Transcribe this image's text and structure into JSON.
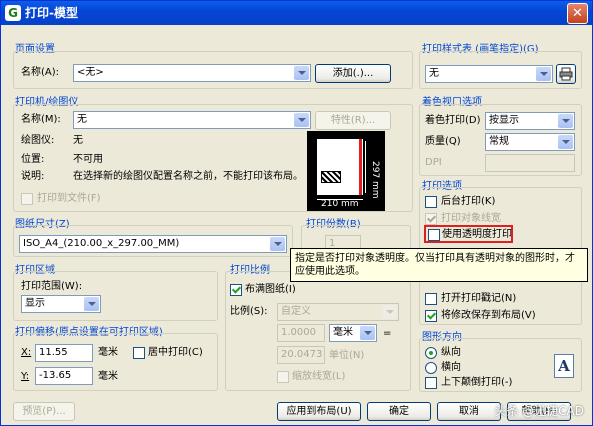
{
  "window": {
    "title": "打印-模型",
    "app_icon": "G"
  },
  "page_setup": {
    "header": "页面设置",
    "name_label": "名称(A):",
    "name_value": "<无>",
    "add_button": "添加(.)..."
  },
  "printer": {
    "header": "打印机/绘图仪",
    "name_label": "名称(M):",
    "name_value": "无",
    "properties_button": "特性(R)...",
    "plotter_label": "绘图仪:",
    "plotter_value": "无",
    "location_label": "位置:",
    "location_value": "不可用",
    "desc_label": "说明:",
    "desc_value": "在选择新的绘图仪配置名称之前，不能打印该布局。",
    "print_to_file": "打印到文件(F)",
    "preview_width": "210 mm",
    "preview_height": "297 mm"
  },
  "paper_size": {
    "header": "图纸尺寸(Z)",
    "value": "ISO_A4_(210.00_x_297.00_MM)"
  },
  "copies": {
    "header": "打印份数(B)",
    "value": "1"
  },
  "plot_area": {
    "header": "打印区域",
    "range_label": "打印范围(W):",
    "range_value": "显示"
  },
  "plot_offset": {
    "header": "打印偏移(原点设置在可打印区域)",
    "x_label": "X:",
    "x_value": "11.55",
    "x_unit": "毫米",
    "y_label": "Y:",
    "y_value": "-13.65",
    "y_unit": "毫米",
    "center": "居中打印(C)"
  },
  "plot_scale": {
    "header": "打印比例",
    "fit": "布满图纸(I)",
    "scale_label": "比例(S):",
    "scale_value": "自定义",
    "v1": "1.0000",
    "unit": "毫米",
    "eq": "=",
    "v2": "20.0473",
    "unit2": "单位(N)",
    "scale_lineweights": "缩放线宽(L)"
  },
  "plot_style_table": {
    "header": "打印样式表 (画笔指定)(G)",
    "value": "无"
  },
  "shaded_viewport": {
    "header": "着色视口选项",
    "shade_label": "着色打印(D)",
    "shade_value": "按显示",
    "quality_label": "质量(Q)",
    "quality_value": "常规",
    "dpi_label": "DPI"
  },
  "plot_options": {
    "header": "打印选项",
    "background": "后台打印(K)",
    "lineweights": "打印对象线宽",
    "transparency": "使用透明度打印",
    "stamp": "打开打印戳记(N)",
    "save_changes": "将修改保存到布局(V)"
  },
  "orientation": {
    "header": "图形方向",
    "portrait": "纵向",
    "landscape": "横向",
    "upside_down": "上下颠倒打印(-)",
    "icon_letter": "A"
  },
  "tooltip": "指定是否打印对象透明度。仅当打印具有透明对象的图形时，才应使用此选项。",
  "footer": {
    "preview": "预览(P)...",
    "apply": "应用到布局(U)",
    "ok": "确定",
    "cancel": "取消",
    "help": "帮助(H)"
  },
  "watermark": "头条 @迅捷CAD"
}
